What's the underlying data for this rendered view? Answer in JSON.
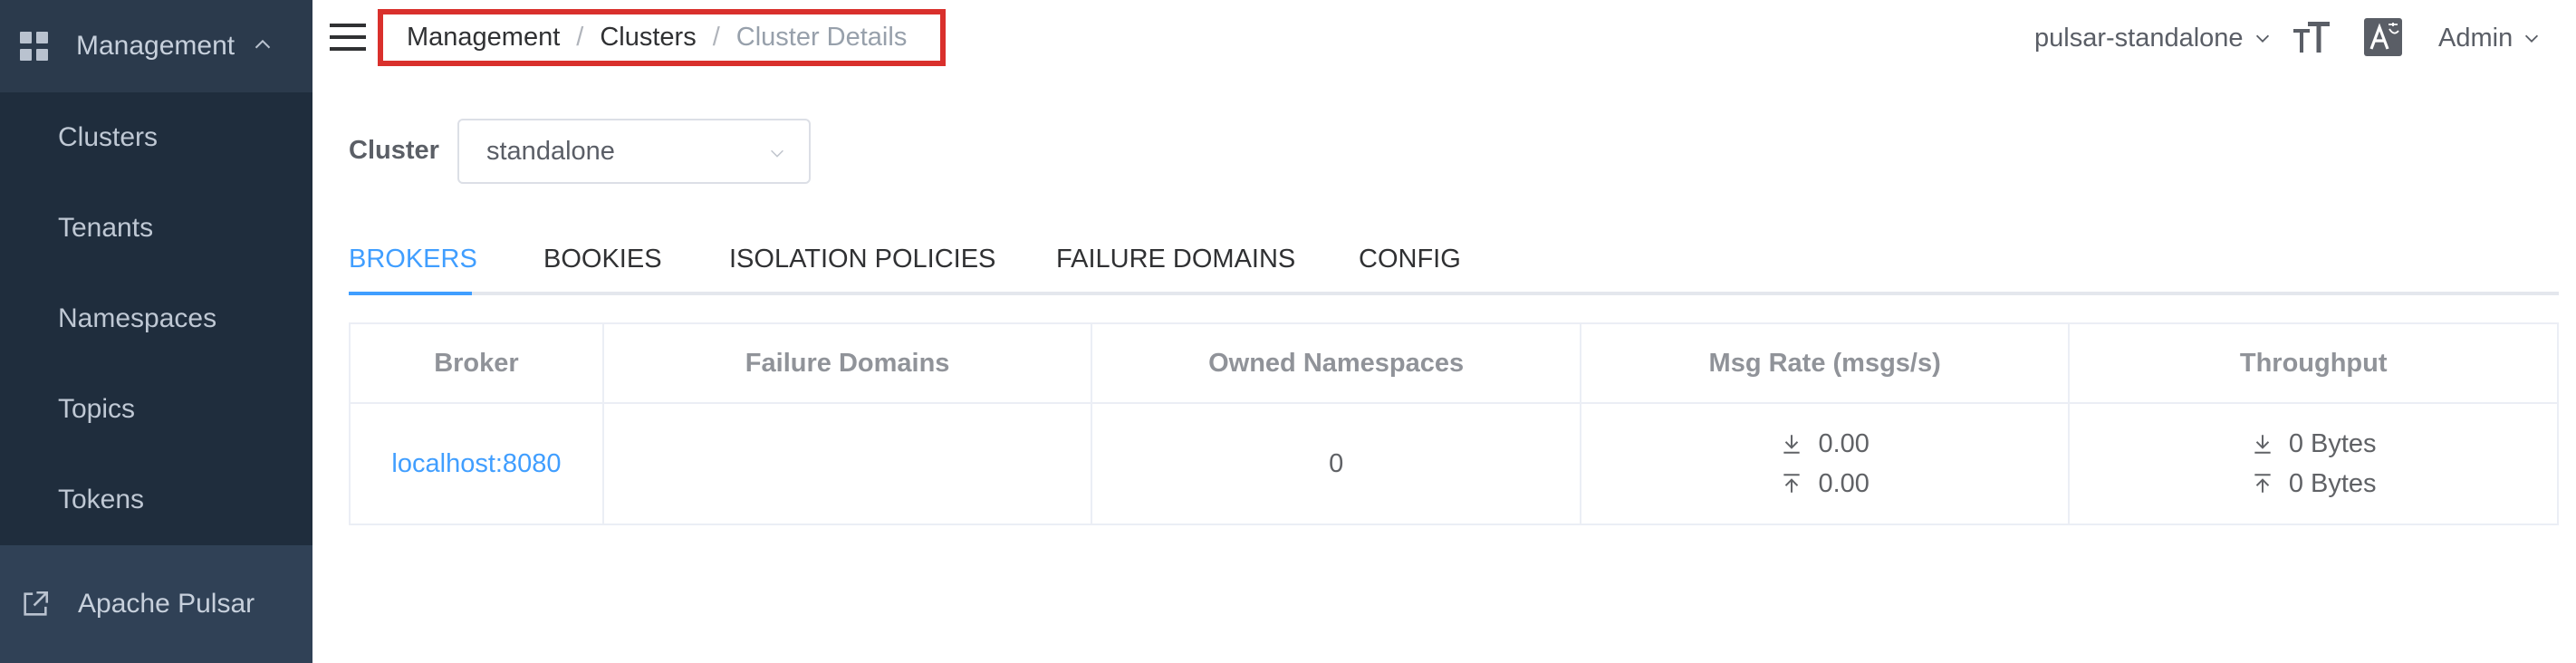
{
  "sidebar": {
    "section_label": "Management",
    "items": [
      {
        "label": "Clusters"
      },
      {
        "label": "Tenants"
      },
      {
        "label": "Namespaces"
      },
      {
        "label": "Topics"
      },
      {
        "label": "Tokens"
      }
    ],
    "footer_link": "Apache Pulsar"
  },
  "breadcrumb": {
    "items": [
      "Management",
      "Clusters",
      "Cluster Details"
    ],
    "separator": "/"
  },
  "header": {
    "environment": "pulsar-standalone",
    "user": "Admin"
  },
  "cluster": {
    "label": "Cluster",
    "selected": "standalone"
  },
  "tabs": [
    {
      "label": "BROKERS",
      "active": true
    },
    {
      "label": "BOOKIES"
    },
    {
      "label": "ISOLATION POLICIES"
    },
    {
      "label": "FAILURE DOMAINS"
    },
    {
      "label": "CONFIG"
    }
  ],
  "table": {
    "columns": [
      "Broker",
      "Failure Domains",
      "Owned Namespaces",
      "Msg Rate (msgs/s)",
      "Throughput"
    ],
    "rows": [
      {
        "broker": "localhost:8080",
        "failure_domains": "",
        "owned_namespaces": "0",
        "msg_rate_in": "0.00",
        "msg_rate_out": "0.00",
        "throughput_in": "0 Bytes",
        "throughput_out": "0 Bytes"
      }
    ]
  },
  "icons": {
    "section": "dashboard-grid-icon",
    "collapse": "chevron-up-icon",
    "external": "external-link-icon",
    "menu": "hamburger-icon",
    "font_size": "font-size-icon",
    "language": "translate-icon",
    "download": "download-arrow-icon",
    "upload": "upload-arrow-icon"
  },
  "colors": {
    "sidebar_bg": "#304156",
    "submenu_bg": "#1f2d3d",
    "accent": "#409eff",
    "highlight_border": "#d9302c"
  }
}
